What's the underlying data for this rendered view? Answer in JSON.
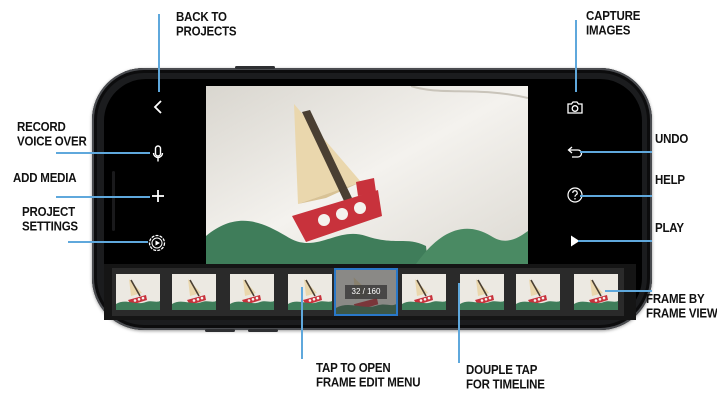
{
  "annotations": {
    "back": {
      "lines": [
        "BACK TO",
        "PROJECTS"
      ]
    },
    "capture": {
      "lines": [
        "CAPTURE",
        "IMAGES"
      ]
    },
    "record": {
      "lines": [
        "RECORD",
        "VOICE OVER"
      ]
    },
    "undo": {
      "lines": [
        "UNDO"
      ]
    },
    "add_media": {
      "lines": [
        "ADD MEDIA"
      ]
    },
    "help": {
      "lines": [
        "HELP"
      ]
    },
    "project_settings": {
      "lines": [
        "PROJECT",
        "SETTINGS"
      ]
    },
    "play": {
      "lines": [
        "PLAY"
      ]
    },
    "frame_view": {
      "lines": [
        "FRAME BY",
        "FRAME VIEW"
      ]
    },
    "frame_edit": {
      "lines": [
        "TAP TO OPEN",
        "FRAME EDIT MENU"
      ]
    },
    "timeline": {
      "lines": [
        "DOUPLE TAP",
        "FOR TIMELINE"
      ]
    }
  },
  "toolbar_left": {
    "icons": [
      "back-chevron-icon",
      "microphone-icon",
      "plus-icon",
      "settings-play-icon"
    ]
  },
  "toolbar_right": {
    "icons": [
      "camera-icon",
      "undo-icon",
      "help-icon",
      "play-icon"
    ]
  },
  "timeline": {
    "frame_counter": "32 / 160",
    "current_frame": 32,
    "total_frames": 160
  },
  "colors": {
    "accent_line": "#5fa8dc",
    "selection_border": "#2a78c8",
    "boat_hull": "#c8323c",
    "boat_sail": "#e8d5a8",
    "waves": "#3f7d5a"
  }
}
